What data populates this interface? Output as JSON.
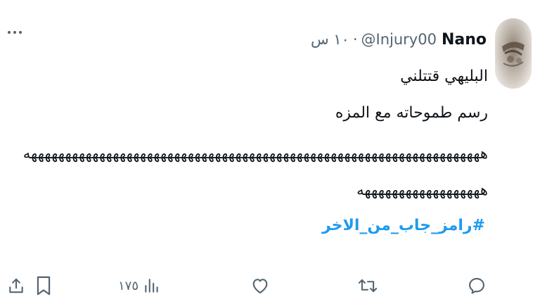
{
  "tweet": {
    "display_name": "Nano",
    "handle": "@Injury00",
    "separator": "·",
    "time": "١٠ س",
    "lines": [
      "البليهي قتتلني",
      "رسم طموحاته مع المزه",
      "هههههههههههههههههههههههههههههههههههههههههههههههههههههههههههههههههههه",
      "ههههههههههههههههههه"
    ],
    "hashtag": "#رامز_جاب_من_الاخر"
  },
  "actions": {
    "views_count": "١٧٥",
    "icons": [
      "reply-icon",
      "retweet-icon",
      "like-icon",
      "views-icon",
      "bookmark-icon",
      "share-icon"
    ]
  },
  "colors": {
    "text": "#0f1419",
    "secondary": "#536471",
    "link": "#1d9bf0"
  }
}
